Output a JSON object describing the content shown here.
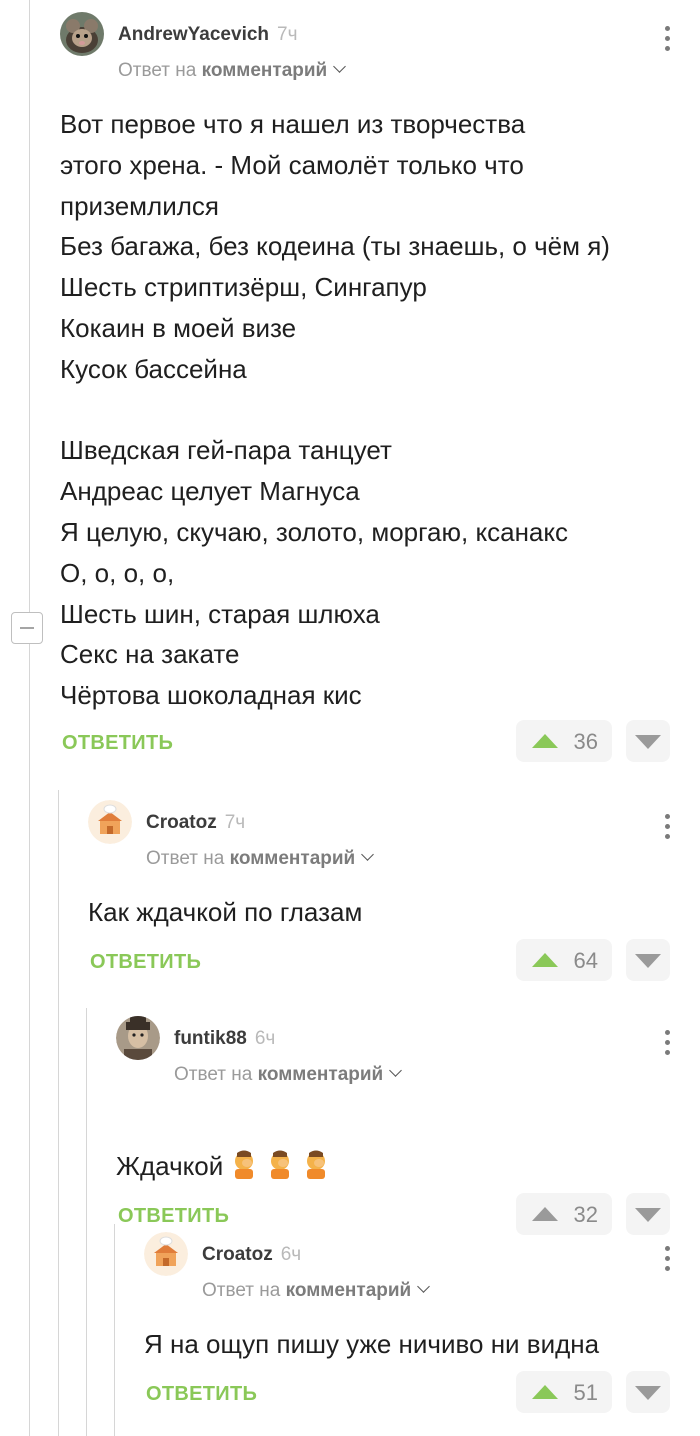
{
  "comments": [
    {
      "author": "AndrewYacevich",
      "time": "7ч",
      "reply_prefix": "Ответ на",
      "reply_target": "комментарий",
      "text": "Вот первое что я нашел из творчества\nэтого хрена. - Мой самолёт только что\nприземлился\nБез багажа, без кодеина (ты знаешь, о чём я)\nШесть стриптизёрш, Сингапур\nКокаин в моей визе\nКусок бассейна\n\nШведская гей-пара танцует\nАндреас целует Магнуса\nЯ целую, скучаю, золото, моргаю, ксанакс\nО, о, о, о,\nШесть шин, старая шлюха\nСекс на закате\nЧёртова шоколадная кис",
      "reply_label": "ОТВЕТИТЬ",
      "rating": "36",
      "upvoted": true,
      "avatar": "rat-avatar"
    },
    {
      "author": "Croatoz",
      "time": "7ч",
      "reply_prefix": "Ответ на",
      "reply_target": "комментарий",
      "text": "Как ждачкой по глазам",
      "reply_label": "ОТВЕТИТЬ",
      "rating": "64",
      "upvoted": true,
      "avatar": "chef-house-avatar"
    },
    {
      "author": "funtik88",
      "time": "6ч",
      "reply_prefix": "Ответ на",
      "reply_target": "комментарий",
      "text": "Ждачкой",
      "reply_label": "ОТВЕТИТЬ",
      "rating": "32",
      "upvoted": false,
      "avatar": "portrait-avatar",
      "emojis": [
        "facepalm-icon",
        "facepalm-icon",
        "facepalm-icon"
      ]
    },
    {
      "author": "Croatoz",
      "time": "6ч",
      "reply_prefix": "Ответ на",
      "reply_target": "комментарий",
      "text": "Я на ощуп пишу уже ничиво ни видна",
      "reply_label": "ОТВЕТИТЬ",
      "rating": "51",
      "upvoted": true,
      "avatar": "chef-house-avatar"
    }
  ],
  "colors": {
    "accent_green": "#8ac858",
    "thread_line": "#d6d6d6",
    "vote_bg": "#f4f4f4"
  }
}
